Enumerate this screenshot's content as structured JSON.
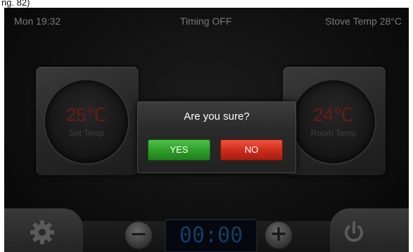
{
  "caption": "ng. 82)",
  "status_bar": {
    "day_time": "Mon  19:32",
    "timing": "Timing  OFF",
    "stove_temp": "Stove Temp 28°C"
  },
  "set_temp": {
    "value": "25℃",
    "label": "Set Temp"
  },
  "room_temp": {
    "value": "24℃",
    "label": "Room Temp"
  },
  "dialog": {
    "title": "Are you sure?",
    "yes_label": "YES",
    "no_label": "NO"
  },
  "bottom": {
    "timer": "00:00",
    "minus_symbol": "−",
    "plus_symbol": "+"
  },
  "icons": {
    "settings": "gear-icon",
    "power": "power-icon"
  },
  "colors": {
    "yes": "#2f9f2a",
    "no": "#cc2e1c",
    "temp_value": "#6a1a14",
    "timer": "#153b66"
  }
}
